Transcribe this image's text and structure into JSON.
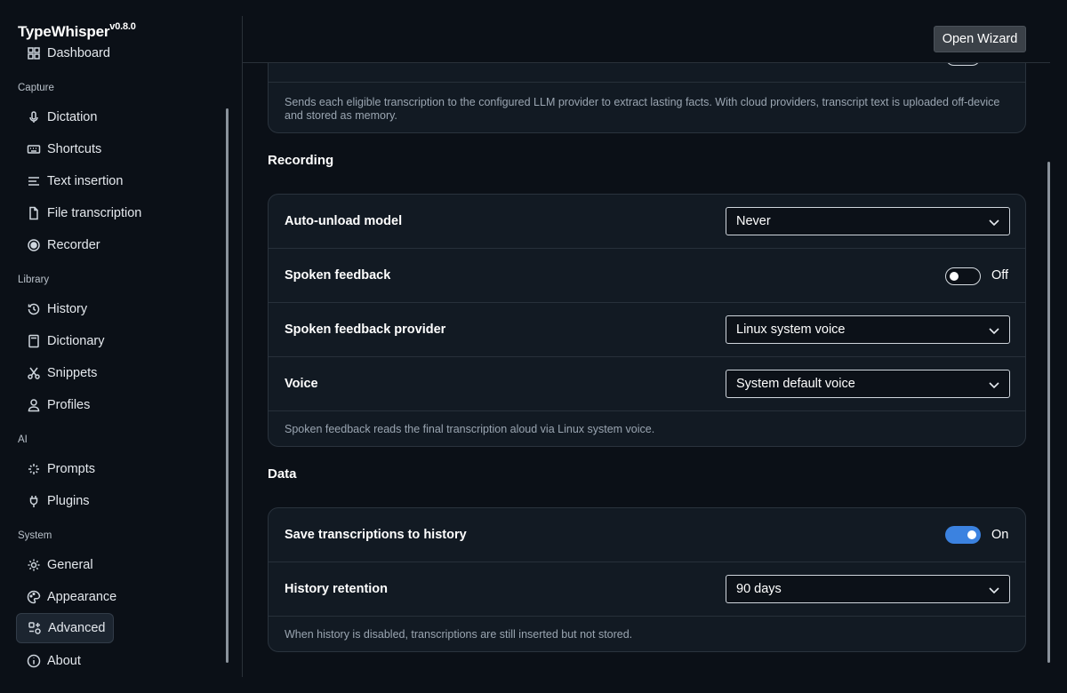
{
  "app": {
    "name": "TypeWhisper",
    "version": "v0.8.0"
  },
  "sidebar": {
    "partial_item": "Dashboard",
    "sections": [
      {
        "label": "Capture",
        "items": [
          {
            "label": "Dictation",
            "icon": "microphone-icon"
          },
          {
            "label": "Shortcuts",
            "icon": "keyboard-icon"
          },
          {
            "label": "Text insertion",
            "icon": "text-lines-icon"
          },
          {
            "label": "File transcription",
            "icon": "file-icon"
          },
          {
            "label": "Recorder",
            "icon": "record-icon"
          }
        ]
      },
      {
        "label": "Library",
        "items": [
          {
            "label": "History",
            "icon": "history-icon"
          },
          {
            "label": "Dictionary",
            "icon": "book-icon"
          },
          {
            "label": "Snippets",
            "icon": "scissors-icon"
          },
          {
            "label": "Profiles",
            "icon": "user-icon"
          }
        ]
      },
      {
        "label": "AI",
        "items": [
          {
            "label": "Prompts",
            "icon": "sparkle-icon"
          },
          {
            "label": "Plugins",
            "icon": "plug-icon"
          }
        ]
      },
      {
        "label": "System",
        "items": [
          {
            "label": "General",
            "icon": "gear-icon"
          },
          {
            "label": "Appearance",
            "icon": "palette-icon"
          },
          {
            "label": "Advanced",
            "icon": "advanced-icon",
            "active": true
          },
          {
            "label": "About",
            "icon": "info-icon"
          }
        ]
      }
    ]
  },
  "header": {
    "wizard_label": "Open Wizard"
  },
  "memory": {
    "note": "Sends each eligible transcription to the configured LLM provider to extract lasting facts. With cloud providers, transcript text is uploaded off-device and stored as memory."
  },
  "recording": {
    "title": "Recording",
    "auto_unload_label": "Auto-unload model",
    "auto_unload_value": "Never",
    "spoken_feedback_label": "Spoken feedback",
    "spoken_feedback_state": "Off",
    "provider_label": "Spoken feedback provider",
    "provider_value": "Linux system voice",
    "voice_label": "Voice",
    "voice_value": "System default voice",
    "note": "Spoken feedback reads the final transcription aloud via Linux system voice."
  },
  "data": {
    "title": "Data",
    "save_history_label": "Save transcriptions to history",
    "save_history_state": "On",
    "retention_label": "History retention",
    "retention_value": "90 days",
    "note": "When history is disabled, transcriptions are still inserted but not stored."
  },
  "colors": {
    "accent": "#3b82e0",
    "background": "#0b1017",
    "card": "#121a23"
  }
}
